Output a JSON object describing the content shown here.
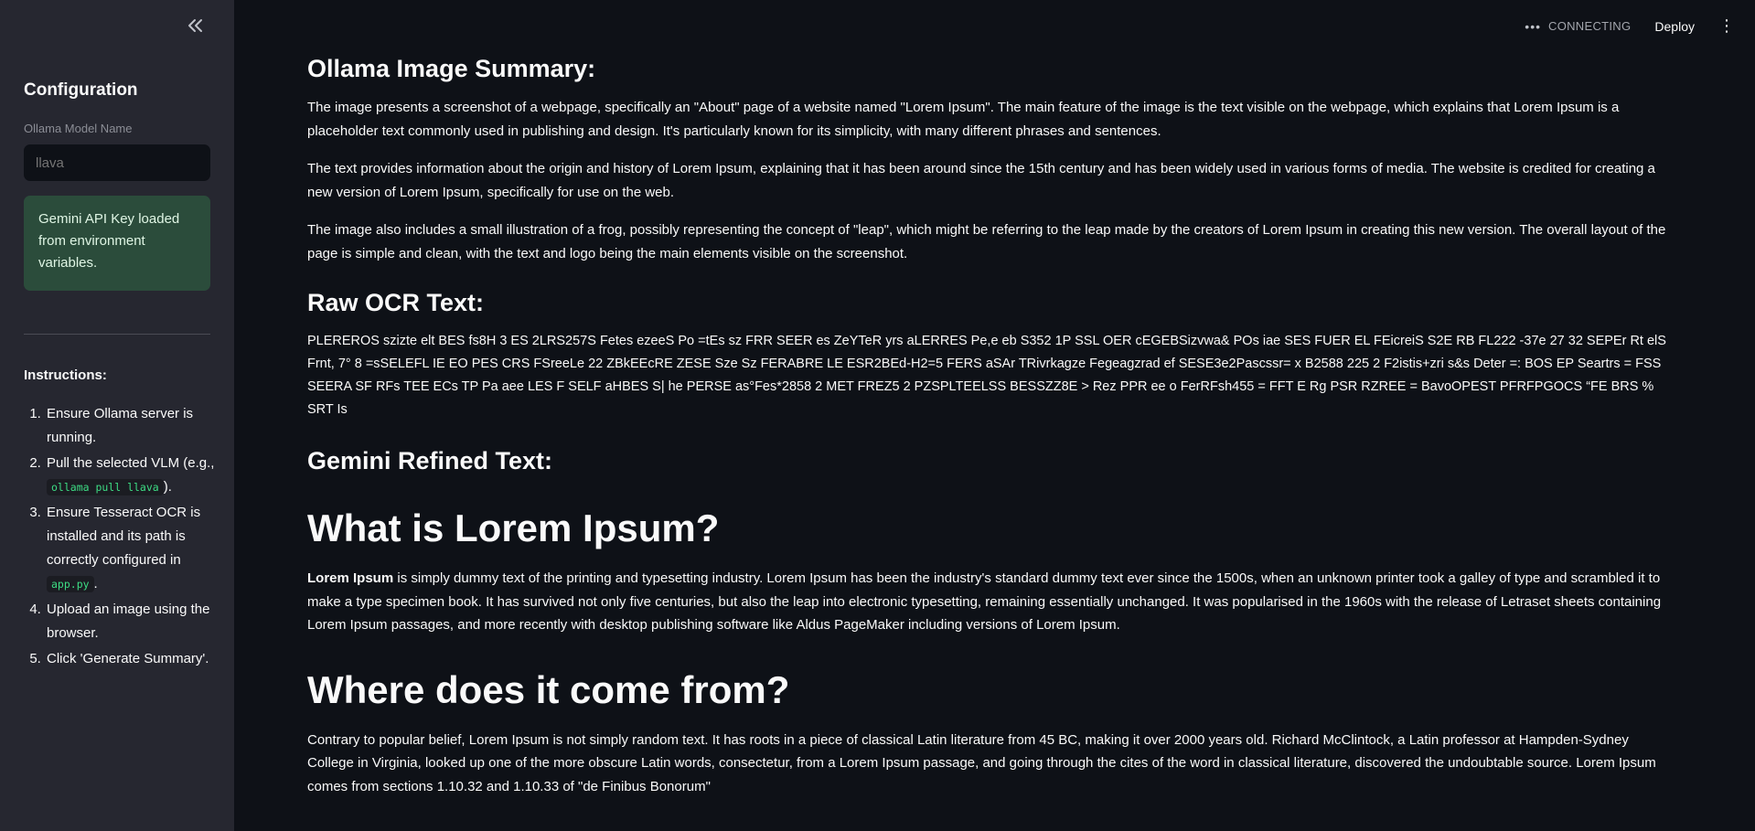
{
  "sidebar": {
    "collapse_icon": "double-chevron-left-icon",
    "title": "Configuration",
    "model_label": "Ollama Model Name",
    "model_placeholder": "llava",
    "alert_text": "Gemini API Key loaded from environment variables.",
    "instructions_title": "Instructions:",
    "instructions": {
      "s1": "Ensure Ollama server is running.",
      "s2_pre": "Pull the selected VLM (e.g., ",
      "s2_code": "ollama pull llava",
      "s2_post": ").",
      "s3_pre": "Ensure Tesseract OCR is installed and its path is correctly configured in ",
      "s3_code": "app.py",
      "s3_post": ".",
      "s4": "Upload an image using the browser.",
      "s5": "Click 'Generate Summary'."
    }
  },
  "header": {
    "status": "CONNECTING",
    "deploy": "Deploy",
    "menu_icon": "vertical-dots-icon"
  },
  "main": {
    "summary_heading": "Ollama Image Summary:",
    "summary_p1": "The image presents a screenshot of a webpage, specifically an \"About\" page of a website named \"Lorem Ipsum\". The main feature of the image is the text visible on the webpage, which explains that Lorem Ipsum is a placeholder text commonly used in publishing and design. It's particularly known for its simplicity, with many different phrases and sentences.",
    "summary_p2": "The text provides information about the origin and history of Lorem Ipsum, explaining that it has been around since the 15th century and has been widely used in various forms of media. The website is credited for creating a new version of Lorem Ipsum, specifically for use on the web.",
    "summary_p3": "The image also includes a small illustration of a frog, possibly representing the concept of \"leap\", which might be referring to the leap made by the creators of Lorem Ipsum in creating this new version. The overall layout of the page is simple and clean, with the text and logo being the main elements visible on the screenshot.",
    "ocr_heading": "Raw OCR Text:",
    "ocr_text": "PLEREROS szizte elt BES fs8H 3 ES 2LRS257S Fetes ezeeS Po =tEs sz FRR SEER es ZeYTeR yrs aLERRES Pe,e eb S352 1P SSL OER cEGEBSizvwa& POs iae SES FUER EL FEicreiS S2E RB FL222 -37e 27 32 SEPEr Rt elS Frnt, 7° 8 =sSELEFL IE EO PES CRS FSreeLe 22 ZBkEEcRE ZESE Sze Sz FERABRE LE ESR2BEd-H2=5 FERS aSAr TRivrkagze Fegeagzrad ef SESE3e2Pascssr= x B2588 225 2 F2istis+zri s&s Deter =: BOS EP Seartrs = FSS SEERA SF RFs TEE ECs TP Pa aee LES F SELF aHBES S| he PERSE as°Fes*2858 2 MET FREZ5 2 PZSPLTEELSS BESSZZ8E > Rez PPR ee o FerRFsh455 = FFT E Rg PSR RZREE = BavoOPEST PFRFPGOCS “FE BRS % SRT Is",
    "gemini_heading": "Gemini Refined Text:",
    "lorem_h1": "What is Lorem Ipsum?",
    "lorem_bold": "Lorem Ipsum",
    "lorem_p": " is simply dummy text of the printing and typesetting industry. Lorem Ipsum has been the industry's standard dummy text ever since the 1500s, when an unknown printer took a galley of type and scrambled it to make a type specimen book. It has survived not only five centuries, but also the leap into electronic typesetting, remaining essentially unchanged. It was popularised in the 1960s with the release of Letraset sheets containing Lorem Ipsum passages, and more recently with desktop publishing software like Aldus PageMaker including versions of Lorem Ipsum.",
    "origin_h1": "Where does it come from?",
    "origin_p": "Contrary to popular belief, Lorem Ipsum is not simply random text. It has roots in a piece of classical Latin literature from 45 BC, making it over 2000 years old. Richard McClintock, a Latin professor at Hampden-Sydney College in Virginia, looked up one of the more obscure Latin words, consectetur, from a Lorem Ipsum passage, and going through the cites of the word in classical literature, discovered the undoubtable source. Lorem Ipsum comes from sections 1.10.32 and 1.10.33 of \"de Finibus Bonorum\""
  }
}
